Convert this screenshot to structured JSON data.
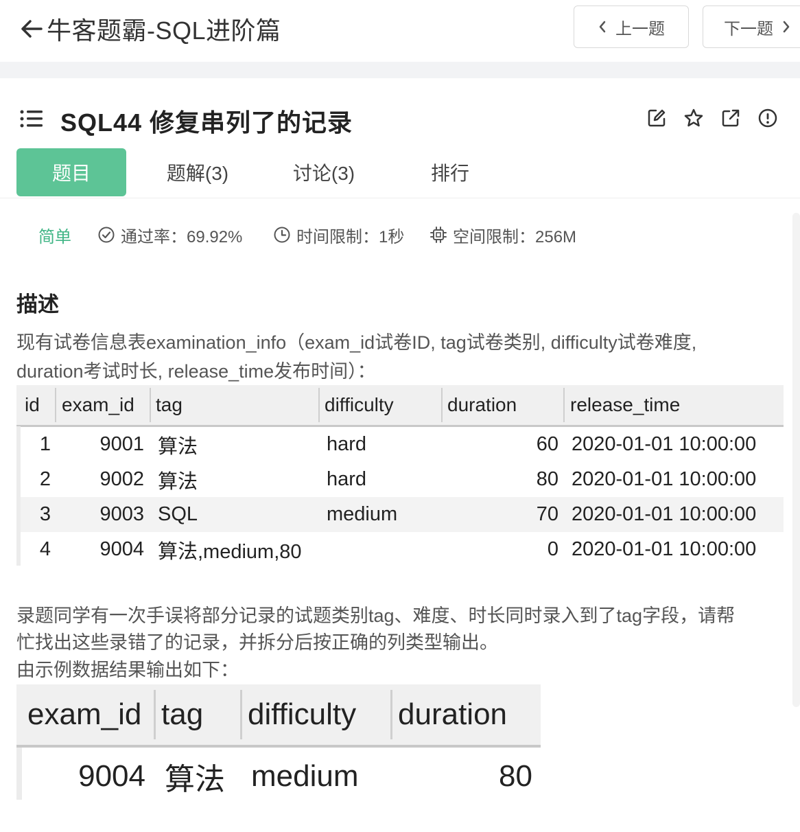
{
  "header": {
    "back_title": "牛客题霸-SQL进阶篇",
    "prev_label": "上一题",
    "next_label": "下一题"
  },
  "problem": {
    "title": "SQL44  修复串列了的记录",
    "toolbar_icons": [
      "edit-icon",
      "star-icon",
      "external-link-icon",
      "info-icon"
    ]
  },
  "tabs": [
    {
      "label": "题目",
      "active": true
    },
    {
      "label": "题解(3)",
      "active": false
    },
    {
      "label": "讨论(3)",
      "active": false
    },
    {
      "label": "排行",
      "active": false
    }
  ],
  "meta": {
    "difficulty": "简单",
    "pass_rate": "通过率：69.92%",
    "time_limit": "时间限制：1秒",
    "space_limit": "空间限制：256M"
  },
  "description": {
    "heading": "描述",
    "intro_line1": "现有试卷信息表examination_info（exam_id试卷ID, tag试卷类别, difficulty试卷难度,",
    "intro_line2": "duration考试时长, release_time发布时间）：",
    "task_line1": "录题同学有一次手误将部分记录的试题类别tag、难度、时长同时录入到了tag字段，请帮",
    "task_line2": "忙找出这些录错了的记录，并拆分后按正确的列类型输出。",
    "result_intro": "由示例数据结果输出如下："
  },
  "table1": {
    "headers": [
      "id",
      "exam_id",
      "tag",
      "difficulty",
      "duration",
      "release_time"
    ],
    "rows": [
      [
        "1",
        "9001",
        "算法",
        "hard",
        "60",
        "2020-01-01 10:00:00"
      ],
      [
        "2",
        "9002",
        "算法",
        "hard",
        "80",
        "2020-01-01 10:00:00"
      ],
      [
        "3",
        "9003",
        "SQL",
        "medium",
        "70",
        "2020-01-01 10:00:00"
      ],
      [
        "4",
        "9004",
        "算法,medium,80",
        "",
        "0",
        "2020-01-01 10:00:00"
      ]
    ]
  },
  "table2": {
    "headers": [
      "exam_id",
      "tag",
      "difficulty",
      "duration"
    ],
    "rows": [
      [
        "9004",
        "算法",
        "medium",
        "80"
      ]
    ]
  },
  "colors": {
    "accent": "#5dc496",
    "easy": "#3fb585"
  }
}
